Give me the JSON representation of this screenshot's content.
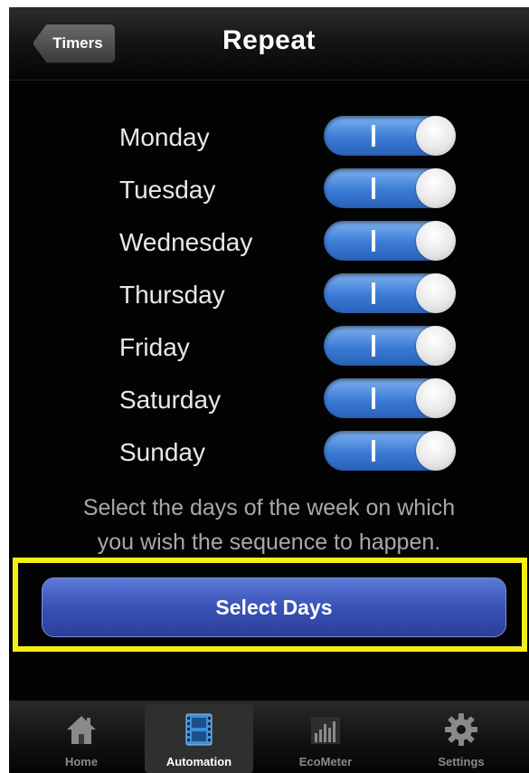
{
  "navbar": {
    "back_label": "Timers",
    "title": "Repeat"
  },
  "days": [
    {
      "label": "Monday",
      "on": true
    },
    {
      "label": "Tuesday",
      "on": true
    },
    {
      "label": "Wednesday",
      "on": true
    },
    {
      "label": "Thursday",
      "on": true
    },
    {
      "label": "Friday",
      "on": true
    },
    {
      "label": "Saturday",
      "on": true
    },
    {
      "label": "Sunday",
      "on": true
    }
  ],
  "hint": {
    "line1": "Select the days of the week on which",
    "line2": "you wish the sequence to happen."
  },
  "select_button": {
    "label": "Select Days",
    "highlight_color": "#f5ee14"
  },
  "tabbar": {
    "active": "Automation",
    "tabs": [
      {
        "label": "Home",
        "icon": "home-icon"
      },
      {
        "label": "Automation",
        "icon": "film-icon"
      },
      {
        "label": "EcoMeter",
        "icon": "bar-chart-icon"
      },
      {
        "label": "Settings",
        "icon": "gear-icon"
      }
    ]
  },
  "colors": {
    "toggle_on": "#3a7bd5",
    "button": "#3a52b6",
    "background": "#030303"
  }
}
